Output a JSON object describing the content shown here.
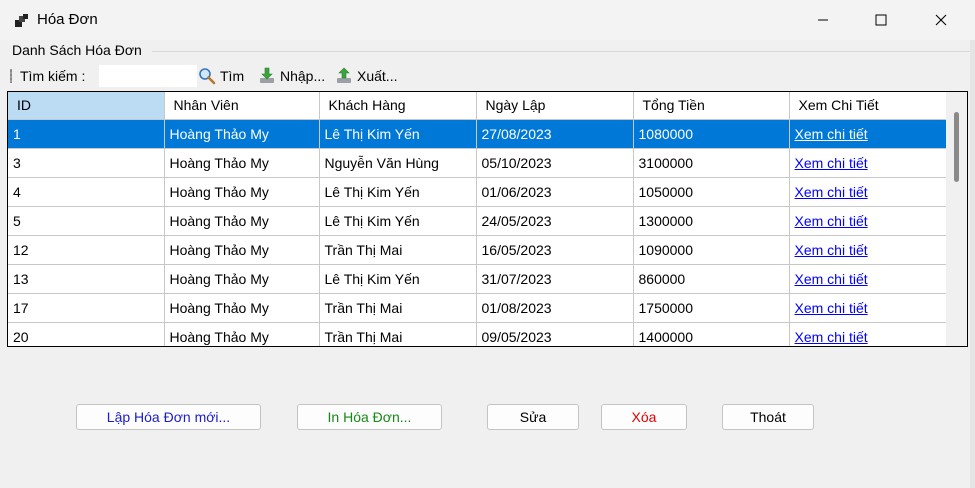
{
  "window": {
    "title": "Hóa Đơn",
    "controls": [
      "minimize-icon",
      "maximize-icon",
      "close-icon"
    ]
  },
  "group": {
    "label": "Danh Sách Hóa Đơn"
  },
  "toolbar": {
    "search_label": "Tìm kiếm :",
    "search_value": "",
    "find_label": "Tìm",
    "find_icon": "magnifier-icon",
    "import_label": "Nhập...",
    "import_icon": "green-arrow-down-icon",
    "export_label": "Xuất...",
    "export_icon": "green-arrow-up-icon"
  },
  "grid": {
    "columns": [
      "ID",
      "Nhân Viên",
      "Khách Hàng",
      "Ngày Lập",
      "Tổng Tiền",
      "Xem Chi Tiết"
    ],
    "selected_row_index": 0,
    "rows": [
      [
        "1",
        "Hoàng Thảo My",
        "Lê Thị Kim Yến",
        "27/08/2023",
        "1080000",
        "Xem chi tiết"
      ],
      [
        "3",
        "Hoàng Thảo My",
        "Nguyễn Văn Hùng",
        "05/10/2023",
        "3100000",
        "Xem chi tiết"
      ],
      [
        "4",
        "Hoàng Thảo My",
        "Lê Thị Kim Yến",
        "01/06/2023",
        "1050000",
        "Xem chi tiết"
      ],
      [
        "5",
        "Hoàng Thảo My",
        "Lê Thị Kim Yến",
        "24/05/2023",
        "1300000",
        "Xem chi tiết"
      ],
      [
        "12",
        "Hoàng Thảo My",
        "Trần Thị Mai",
        "16/05/2023",
        "1090000",
        "Xem chi tiết"
      ],
      [
        "13",
        "Hoàng Thảo My",
        "Lê Thị Kim Yến",
        "31/07/2023",
        "860000",
        "Xem chi tiết"
      ],
      [
        "17",
        "Hoàng Thảo My",
        "Trần Thị Mai",
        "01/08/2023",
        "1750000",
        "Xem chi tiết"
      ],
      [
        "20",
        "Hoàng Thảo My",
        "Trần Thị Mai",
        "09/05/2023",
        "1400000",
        "Xem chi tiết"
      ]
    ]
  },
  "buttons": {
    "new_invoice": "Lập Hóa Đơn mới...",
    "print_invoice": "In Hóa Đơn...",
    "edit": "Sửa",
    "delete": "Xóa",
    "exit": "Thoát"
  },
  "colors": {
    "selection": "#0078d7",
    "header_selected": "#bcdcf4",
    "link": "#0000ff",
    "new_button_text": "#1c1ccc",
    "print_button_text": "#158a15",
    "delete_button_text": "#e60000"
  }
}
